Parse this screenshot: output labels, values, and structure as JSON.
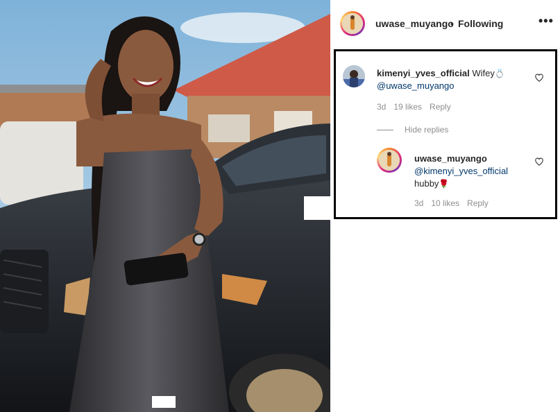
{
  "post": {
    "username": "uwase_muyango",
    "separator": "•",
    "follow_status": "Following",
    "more_icon": "more-options-icon"
  },
  "comment": {
    "username": "kimenyi_yves_official",
    "text": "Wifey",
    "emoji": "💍",
    "mention": "@uwase_muyango",
    "age": "3d",
    "likes": "19 likes",
    "reply_label": "Reply"
  },
  "replies_toggle": {
    "label": "Hide replies"
  },
  "reply": {
    "username": "uwase_muyango",
    "mention": "@kimenyi_yves_official",
    "text": "hubby",
    "emoji": "🌹",
    "age": "3d",
    "likes": "10 likes",
    "reply_label": "Reply"
  },
  "colors": {
    "text": "#262626",
    "secondary": "#8e8e8e",
    "mention": "#00376b",
    "border": "#000000"
  }
}
